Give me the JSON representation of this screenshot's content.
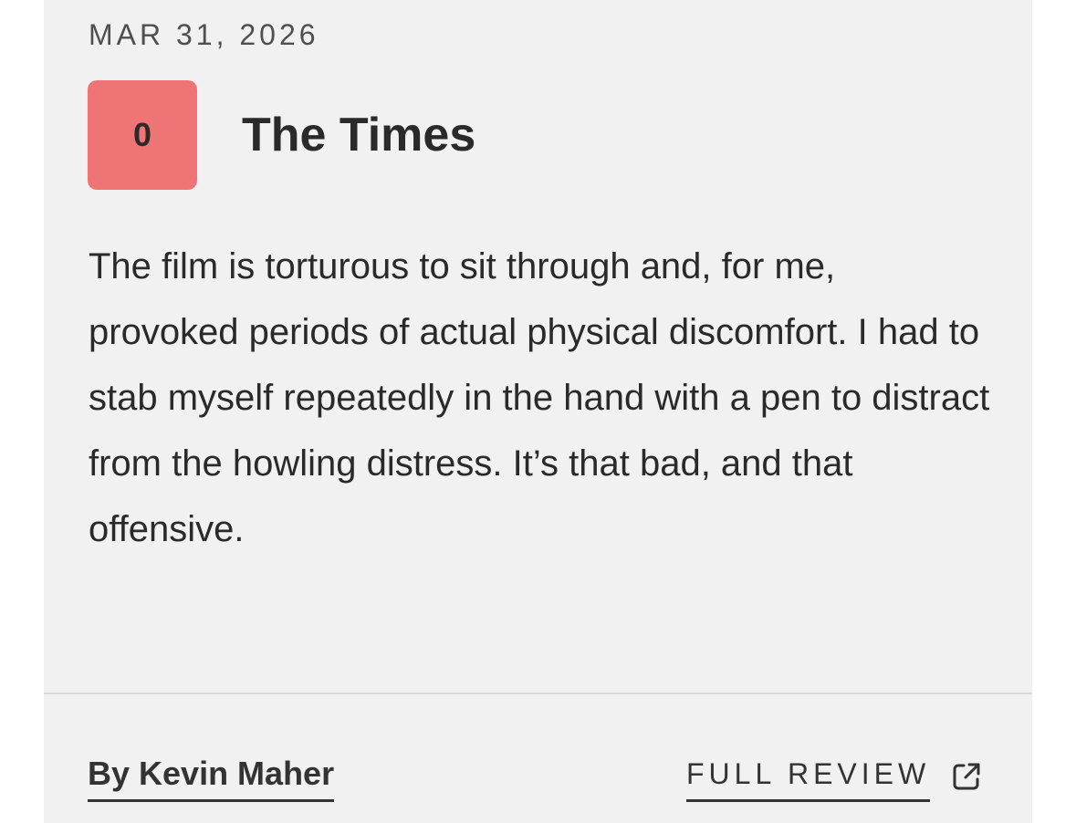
{
  "review": {
    "date": "MAR 31, 2026",
    "score": "0",
    "score_color": "#ef7475",
    "outlet": "The Times",
    "quote": "The film is torturous to sit through and, for me, provoked periods of actual physical discomfort. I had to stab myself repeatedly in the hand with a pen to distract from the howling distress. It’s that bad, and that offensive.",
    "author": "By Kevin Maher",
    "full_review_label": "FULL REVIEW",
    "full_review_icon": "external-link-icon"
  }
}
